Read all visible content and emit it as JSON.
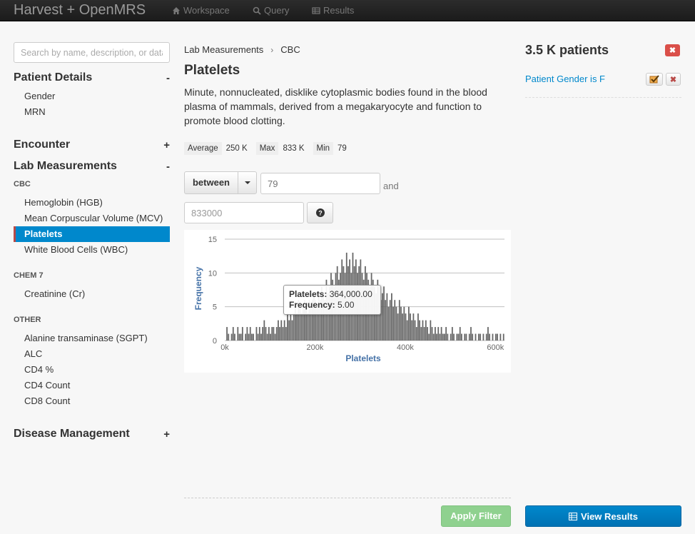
{
  "navbar": {
    "brand": "Harvest + OpenMRS",
    "items": [
      {
        "label": "Workspace",
        "icon": "home-icon"
      },
      {
        "label": "Query",
        "icon": "search-icon"
      },
      {
        "label": "Results",
        "icon": "table-icon"
      }
    ]
  },
  "sidebar": {
    "search_placeholder": "Search by name, description, or data",
    "sections": [
      {
        "label": "Patient Details",
        "toggle": "-"
      },
      {
        "label": "Encounter",
        "toggle": "+"
      },
      {
        "label": "Lab Measurements",
        "toggle": "-"
      },
      {
        "label": "Disease Management",
        "toggle": "+"
      }
    ],
    "patient_items": [
      "Gender",
      "MRN"
    ],
    "groups": [
      {
        "label": "CBC",
        "items": [
          "Hemoglobin (HGB)",
          "Mean Corpuscular Volume (MCV)",
          "Platelets",
          "White Blood Cells (WBC)"
        ]
      },
      {
        "label": "CHEM 7",
        "items": [
          "Creatinine (Cr)"
        ]
      },
      {
        "label": "OTHER",
        "items": [
          "Alanine transaminase (SGPT)",
          "ALC",
          "CD4 %",
          "CD4 Count",
          "CD8 Count"
        ]
      }
    ],
    "active_item": "Platelets"
  },
  "main": {
    "breadcrumb": [
      "Lab Measurements",
      "CBC"
    ],
    "title": "Platelets",
    "description": "Minute, nonnucleated, disklike cytoplasmic bodies found in the blood plasma of mammals, derived from a megakaryocyte and function to promote blood clotting.",
    "stats": [
      {
        "key": "Average",
        "value": "250 K"
      },
      {
        "key": "Max",
        "value": "833 K"
      },
      {
        "key": "Min",
        "value": "79"
      }
    ],
    "operator": "between",
    "min_placeholder": "79",
    "and_label": "and",
    "max_value": "833000",
    "apply_label": "Apply Filter"
  },
  "chart_data": {
    "type": "bar",
    "xlabel": "Platelets",
    "ylabel": "Frequency",
    "xlim": [
      0,
      620000
    ],
    "ylim": [
      0,
      15
    ],
    "x_ticks": [
      "0k",
      "200k",
      "400k",
      "600k"
    ],
    "y_ticks": [
      "0",
      "5",
      "10",
      "15"
    ],
    "grid": true,
    "bar_color": "#666666",
    "tooltip": {
      "label_key": "Platelets:",
      "label_value": "364,000.00",
      "freq_key": "Frequency:",
      "freq_value": "5.00"
    },
    "bins": [
      0,
      2,
      1,
      0,
      1,
      2,
      1,
      0,
      2,
      1,
      1,
      2,
      0,
      1,
      2,
      1,
      2,
      1,
      1,
      0,
      2,
      1,
      2,
      1,
      2,
      3,
      2,
      1,
      2,
      1,
      2,
      2,
      1,
      2,
      3,
      2,
      3,
      2,
      3,
      2,
      4,
      3,
      4,
      3,
      4,
      5,
      4,
      6,
      5,
      4,
      5,
      6,
      5,
      4,
      6,
      5,
      6,
      7,
      6,
      5,
      7,
      6,
      8,
      7,
      6,
      9,
      7,
      8,
      10,
      9,
      8,
      10,
      11,
      9,
      10,
      12,
      11,
      10,
      13,
      11,
      12,
      10,
      13,
      11,
      12,
      10,
      11,
      12,
      10,
      9,
      11,
      10,
      9,
      8,
      10,
      9,
      8,
      7,
      9,
      8,
      6,
      7,
      8,
      6,
      7,
      5,
      6,
      7,
      5,
      6,
      5,
      4,
      6,
      5,
      4,
      5,
      4,
      3,
      5,
      4,
      3,
      4,
      3,
      2,
      4,
      3,
      2,
      3,
      2,
      3,
      2,
      1,
      3,
      2,
      1,
      2,
      1,
      2,
      1,
      2,
      1,
      1,
      2,
      1,
      0,
      1,
      2,
      1,
      0,
      1,
      1,
      2,
      1,
      0,
      1,
      1,
      0,
      1,
      2,
      1,
      0,
      1,
      0,
      1,
      1,
      0,
      1,
      0,
      1,
      2,
      1,
      0,
      1,
      0,
      1,
      1,
      0,
      1,
      0,
      1
    ]
  },
  "right": {
    "count": "3.5 K patients",
    "filter_label": "Patient Gender is F",
    "view_label": "View Results"
  },
  "colors": {
    "accent": "#0088cc",
    "danger": "#da4f49",
    "success": "#8fd18f"
  }
}
